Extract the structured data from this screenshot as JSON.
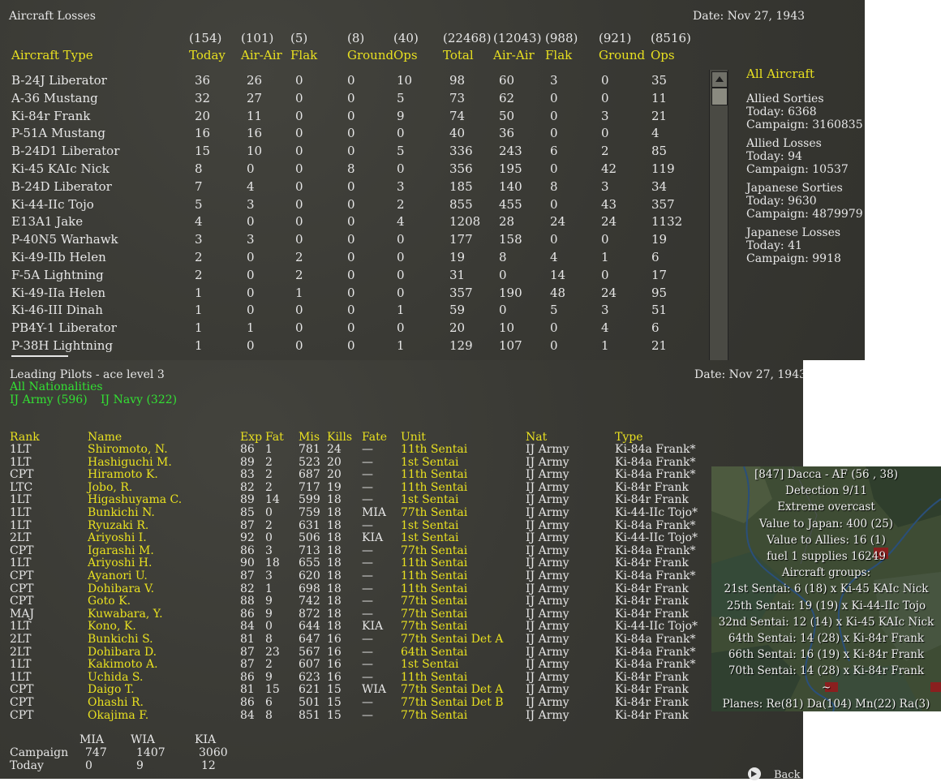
{
  "losses": {
    "title": "Aircraft Losses",
    "date": "Date: Nov 27, 1943",
    "header_counts": [
      "(154)",
      "(101)",
      "(5)",
      "(8)",
      "(40)",
      "(22468)",
      "(12043)",
      "(988)",
      "(921)",
      "(8516)"
    ],
    "columns": [
      "Aircraft Type",
      "Today",
      "Air-Air",
      "Flak",
      "Ground",
      "Ops",
      "Total",
      "Air-Air",
      "Flak",
      "Ground",
      "Ops"
    ],
    "rows": [
      [
        "B-24J Liberator",
        "36",
        "26",
        "0",
        "0",
        "10",
        "98",
        "60",
        "3",
        "0",
        "35"
      ],
      [
        "A-36 Mustang",
        "32",
        "27",
        "0",
        "0",
        "5",
        "73",
        "62",
        "0",
        "0",
        "11"
      ],
      [
        "Ki-84r Frank",
        "20",
        "11",
        "0",
        "0",
        "9",
        "74",
        "50",
        "0",
        "3",
        "21"
      ],
      [
        "P-51A Mustang",
        "16",
        "16",
        "0",
        "0",
        "0",
        "40",
        "36",
        "0",
        "0",
        "4"
      ],
      [
        "B-24D1 Liberator",
        "15",
        "10",
        "0",
        "0",
        "5",
        "336",
        "243",
        "6",
        "2",
        "85"
      ],
      [
        "Ki-45 KAIc Nick",
        "8",
        "0",
        "0",
        "8",
        "0",
        "356",
        "195",
        "0",
        "42",
        "119"
      ],
      [
        "B-24D Liberator",
        "7",
        "4",
        "0",
        "0",
        "3",
        "185",
        "140",
        "8",
        "3",
        "34"
      ],
      [
        "Ki-44-IIc Tojo",
        "5",
        "3",
        "0",
        "0",
        "2",
        "855",
        "455",
        "0",
        "43",
        "357"
      ],
      [
        "E13A1 Jake",
        "4",
        "0",
        "0",
        "0",
        "4",
        "1208",
        "28",
        "24",
        "24",
        "1132"
      ],
      [
        "P-40N5 Warhawk",
        "3",
        "3",
        "0",
        "0",
        "0",
        "177",
        "158",
        "0",
        "0",
        "19"
      ],
      [
        "Ki-49-IIb Helen",
        "2",
        "0",
        "2",
        "0",
        "0",
        "19",
        "8",
        "4",
        "1",
        "6"
      ],
      [
        "F-5A Lightning",
        "2",
        "0",
        "2",
        "0",
        "0",
        "31",
        "0",
        "14",
        "0",
        "17"
      ],
      [
        "Ki-49-IIa Helen",
        "1",
        "0",
        "1",
        "0",
        "0",
        "357",
        "190",
        "48",
        "24",
        "95"
      ],
      [
        "Ki-46-III Dinah",
        "1",
        "0",
        "0",
        "0",
        "1",
        "59",
        "0",
        "5",
        "3",
        "51"
      ],
      [
        "PB4Y-1 Liberator",
        "1",
        "1",
        "0",
        "0",
        "0",
        "20",
        "10",
        "0",
        "4",
        "6"
      ],
      [
        "P-38H Lightning",
        "1",
        "0",
        "0",
        "0",
        "1",
        "129",
        "107",
        "0",
        "1",
        "21"
      ]
    ],
    "side": {
      "heading": "All Aircraft",
      "stats": [
        {
          "label": "Allied Sorties",
          "today": "Today:   6368",
          "campaign": "Campaign: 3160835"
        },
        {
          "label": "Allied Losses",
          "today": "Today:   94",
          "campaign": "Campaign: 10537"
        },
        {
          "label": "Japanese Sorties",
          "today": "Today:   9630",
          "campaign": "Campaign: 4879979"
        },
        {
          "label": "Japanese Losses",
          "today": "Today:   41",
          "campaign": "Campaign: 9918"
        }
      ]
    }
  },
  "pilots": {
    "title": "Leading Pilots - ace level 3",
    "date": "Date: Nov 27, 1943",
    "filter_all": "All Nationalities",
    "filter_army": "IJ Army (596)",
    "filter_navy": "IJ Navy (322)",
    "columns": [
      "Rank",
      "Name",
      "Exp",
      "Fat",
      "Mis",
      "Kills",
      "Fate",
      "Unit",
      "Nat",
      "Type"
    ],
    "rows": [
      [
        "1LT",
        "Shiromoto, N.",
        "86",
        "1",
        "781",
        "24",
        "—",
        "11th Sentai",
        "IJ Army",
        "Ki-84a Frank*"
      ],
      [
        "1LT",
        "Hashiguchi M.",
        "89",
        "2",
        "523",
        "20",
        "—",
        "1st Sentai",
        "IJ Army",
        "Ki-84a Frank*"
      ],
      [
        "CPT",
        "Hiramoto K.",
        "83",
        "2",
        "687",
        "20",
        "—",
        "11th Sentai",
        "IJ Army",
        "Ki-84a Frank*"
      ],
      [
        "LTC",
        "Jobo, R.",
        "82",
        "2",
        "717",
        "19",
        "—",
        "11th Sentai",
        "IJ Army",
        "Ki-84r Frank"
      ],
      [
        "1LT",
        "Higashuyama C.",
        "89",
        "14",
        "599",
        "18",
        "—",
        "1st Sentai",
        "IJ Army",
        "Ki-84r Frank"
      ],
      [
        "1LT",
        "Bunkichi N.",
        "85",
        "0",
        "759",
        "18",
        "MIA",
        "77th Sentai",
        "IJ Army",
        "Ki-44-IIc Tojo*"
      ],
      [
        "1LT",
        "Ryuzaki R.",
        "87",
        "2",
        "631",
        "18",
        "—",
        "1st Sentai",
        "IJ Army",
        "Ki-84a Frank*"
      ],
      [
        "2LT",
        "Ariyoshi I.",
        "92",
        "0",
        "506",
        "18",
        "KIA",
        "1st Sentai",
        "IJ Army",
        "Ki-44-IIc Tojo*"
      ],
      [
        "CPT",
        "Igarashi M.",
        "86",
        "3",
        "713",
        "18",
        "—",
        "77th Sentai",
        "IJ Army",
        "Ki-84a Frank*"
      ],
      [
        "1LT",
        "Ariyoshi H.",
        "90",
        "18",
        "655",
        "18",
        "—",
        "11th Sentai",
        "IJ Army",
        "Ki-84r Frank"
      ],
      [
        "CPT",
        "Ayanori U.",
        "87",
        "3",
        "620",
        "18",
        "—",
        "11th Sentai",
        "IJ Army",
        "Ki-84a Frank*"
      ],
      [
        "CPT",
        "Dohibara V.",
        "82",
        "1",
        "698",
        "18",
        "—",
        "11th Sentai",
        "IJ Army",
        "Ki-84r Frank"
      ],
      [
        "CPT",
        "Goto K.",
        "88",
        "9",
        "742",
        "18",
        "—",
        "77th Sentai",
        "IJ Army",
        "Ki-84r Frank"
      ],
      [
        "MAJ",
        "Kuwabara, Y.",
        "86",
        "9",
        "872",
        "18",
        "—",
        "77th Sentai",
        "IJ Army",
        "Ki-84r Frank"
      ],
      [
        "1LT",
        "Kono, K.",
        "84",
        "0",
        "644",
        "18",
        "KIA",
        "77th Sentai",
        "IJ Army",
        "Ki-44-IIc Tojo*"
      ],
      [
        "2LT",
        "Bunkichi S.",
        "81",
        "8",
        "647",
        "16",
        "—",
        "77th Sentai Det A",
        "IJ Army",
        "Ki-84a Frank*"
      ],
      [
        "2LT",
        "Dohibara D.",
        "87",
        "23",
        "567",
        "16",
        "—",
        "64th Sentai",
        "IJ Army",
        "Ki-84a Frank*"
      ],
      [
        "1LT",
        "Kakimoto A.",
        "87",
        "2",
        "607",
        "16",
        "—",
        "1st Sentai",
        "IJ Army",
        "Ki-84a Frank*"
      ],
      [
        "1LT",
        "Uchida S.",
        "86",
        "9",
        "623",
        "16",
        "—",
        "11th Sentai",
        "IJ Army",
        "Ki-84r Frank"
      ],
      [
        "CPT",
        "Daigo T.",
        "81",
        "15",
        "621",
        "15",
        "WIA",
        "77th Sentai Det A",
        "IJ Army",
        "Ki-84r Frank"
      ],
      [
        "CPT",
        "Ohashi R.",
        "86",
        "6",
        "501",
        "15",
        "—",
        "77th Sentai Det B",
        "IJ Army",
        "Ki-84r Frank"
      ],
      [
        "CPT",
        "Okajima F.",
        "84",
        "8",
        "851",
        "15",
        "—",
        "77th Sentai",
        "IJ Army",
        "Ki-84r Frank"
      ]
    ],
    "totals": {
      "headers": [
        "MIA",
        "WIA",
        "KIA"
      ],
      "campaign_label": "Campaign",
      "campaign": [
        "747",
        "1407",
        "3060"
      ],
      "today_label": "Today",
      "today": [
        "0",
        "9",
        "12"
      ]
    },
    "back_label": "Back"
  },
  "base_popup": {
    "lines": [
      "[847] Dacca - AF (56 , 38)",
      "Detection 9/11",
      "Extreme overcast",
      "Value to Japan: 400 (25)",
      "Value to Allies: 16 (1)",
      "fuel 1  supplies 16249",
      "Aircraft groups:",
      "21st Sentai:  6 (18) x Ki-45 KAIc Nick",
      "25th Sentai:  19 (19) x Ki-44-IIc Tojo",
      "32nd Sentai:  12 (14) x Ki-45 KAIc Nick",
      "64th Sentai:  14 (28) x Ki-84r Frank",
      "66th Sentai:  16 (19) x Ki-84r Frank",
      "70th Sentai:  14 (28) x Ki-84r Frank",
      "~",
      "Planes: Re(81) Da(104) Mn(22) Ra(3)"
    ]
  },
  "colors": {
    "panel": "#3a3a35",
    "header_yellow": "#e8e020",
    "filter_green": "#33e033",
    "text_white": "#e6e6e6"
  }
}
